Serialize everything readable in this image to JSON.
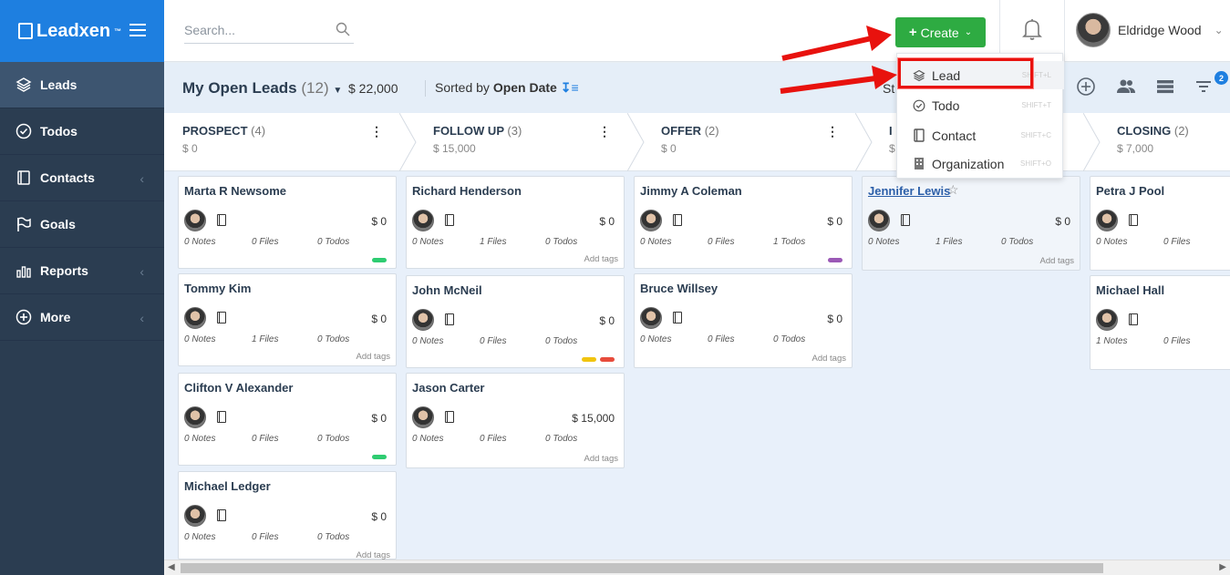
{
  "brand": {
    "name": "Leadxen",
    "tm": "™"
  },
  "sidebar": {
    "items": [
      {
        "label": "Leads",
        "icon": "layers-icon"
      },
      {
        "label": "Todos",
        "icon": "check-circle-icon"
      },
      {
        "label": "Contacts",
        "icon": "address-book-icon"
      },
      {
        "label": "Goals",
        "icon": "flag-icon"
      },
      {
        "label": "Reports",
        "icon": "bar-chart-icon"
      },
      {
        "label": "More",
        "icon": "plus-circle-icon"
      }
    ]
  },
  "topbar": {
    "search_placeholder": "Search...",
    "create_label": "Create",
    "user_name": "Eldridge Wood"
  },
  "subheader": {
    "title": "My Open Leads",
    "count": "(12)",
    "amount": "$ 22,000",
    "sorted_prefix": "Sorted by",
    "sorted_field": "Open Date",
    "partial_label": "St",
    "filter_badge": "2"
  },
  "dropdown": {
    "items": [
      {
        "label": "Lead",
        "shortcut": "SHIFT+L"
      },
      {
        "label": "Todo",
        "shortcut": "SHIFT+T"
      },
      {
        "label": "Contact",
        "shortcut": "SHIFT+C"
      },
      {
        "label": "Organization",
        "shortcut": "SHIFT+O"
      }
    ]
  },
  "stages": [
    {
      "name": "PROSPECT",
      "count": "(4)",
      "amount": "$ 0"
    },
    {
      "name": "FOLLOW UP",
      "count": "(3)",
      "amount": "$ 15,000"
    },
    {
      "name": "OFFER",
      "count": "(2)",
      "amount": "$ 0"
    },
    {
      "name": "I",
      "count": "",
      "amount": "$"
    },
    {
      "name": "CLOSING",
      "count": "(2)",
      "amount": "$ 7,000"
    }
  ],
  "cards": [
    {
      "name": "Marta R Newsome",
      "value": "$ 0",
      "notes": "0 Notes",
      "files": "0 Files",
      "todos": "0 Todos",
      "tags": ""
    },
    {
      "name": "Tommy Kim",
      "value": "$ 0",
      "notes": "0 Notes",
      "files": "1 Files",
      "todos": "0 Todos",
      "tags": "Add tags"
    },
    {
      "name": "Clifton V Alexander",
      "value": "$ 0",
      "notes": "0 Notes",
      "files": "0 Files",
      "todos": "0 Todos",
      "tags": ""
    },
    {
      "name": "Michael Ledger",
      "value": "$ 0",
      "notes": "0 Notes",
      "files": "0 Files",
      "todos": "0 Todos",
      "tags": "Add tags"
    },
    {
      "name": "Richard Henderson",
      "value": "$ 0",
      "notes": "0 Notes",
      "files": "1 Files",
      "todos": "0 Todos",
      "tags": "Add tags"
    },
    {
      "name": "John McNeil",
      "value": "$ 0",
      "notes": "0 Notes",
      "files": "0 Files",
      "todos": "0 Todos",
      "tags": ""
    },
    {
      "name": "Jason Carter",
      "value": "$ 15,000",
      "notes": "0 Notes",
      "files": "0 Files",
      "todos": "0 Todos",
      "tags": "Add tags"
    },
    {
      "name": "Jimmy A Coleman",
      "value": "$ 0",
      "notes": "0 Notes",
      "files": "0 Files",
      "todos": "1 Todos",
      "tags": ""
    },
    {
      "name": "Bruce Willsey",
      "value": "$ 0",
      "notes": "0 Notes",
      "files": "0 Files",
      "todos": "0 Todos",
      "tags": "Add tags"
    },
    {
      "name": "Jennifer Lewis",
      "value": "$ 0",
      "notes": "0 Notes",
      "files": "1 Files",
      "todos": "0 Todos",
      "tags": "Add tags"
    },
    {
      "name": "Petra J Pool",
      "value": "",
      "notes": "0 Notes",
      "files": "0 Files",
      "todos": "",
      "tags": ""
    },
    {
      "name": "Michael Hall",
      "value": "",
      "notes": "1 Notes",
      "files": "0 Files",
      "todos": "",
      "tags": ""
    }
  ],
  "colors": {
    "brand_blue": "#1e7fe0",
    "sidebar_bg": "#2b3d51",
    "create_green": "#2eab42",
    "highlight_red": "#e8120e",
    "tag_green": "#2ecc71",
    "tag_purple": "#9b59b6",
    "tag_yellow": "#f1c40f",
    "tag_red": "#e74c3c"
  }
}
